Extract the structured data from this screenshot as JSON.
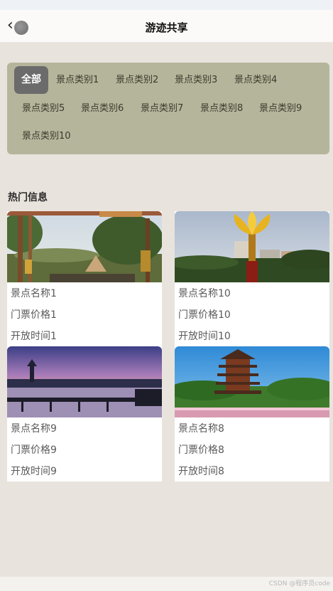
{
  "header": {
    "title": "游迹共享",
    "back_icon": "chevron-left-icon"
  },
  "categories": [
    "全部",
    "景点类别1",
    "景点类别2",
    "景点类别3",
    "景点类别4",
    "景点类别5",
    "景点类别6",
    "景点类别7",
    "景点类别8",
    "景点类别9",
    "景点类别10"
  ],
  "hot": {
    "title": "热门信息",
    "cards": [
      {
        "name": "景点名称1",
        "price": "门票价格1",
        "time": "开放时间1"
      },
      {
        "name": "景点名称10",
        "price": "门票价格10",
        "time": "开放时间10"
      },
      {
        "name": "景点名称9",
        "price": "门票价格9",
        "time": "开放时间9"
      },
      {
        "name": "景点名称8",
        "price": "门票价格8",
        "time": "开放时间8"
      }
    ]
  },
  "watermark": "CSDN @程序员code",
  "colors": {
    "category_panel": "#b5b59b",
    "active_category": "#6b6b6b",
    "background": "#e8e3dc"
  }
}
